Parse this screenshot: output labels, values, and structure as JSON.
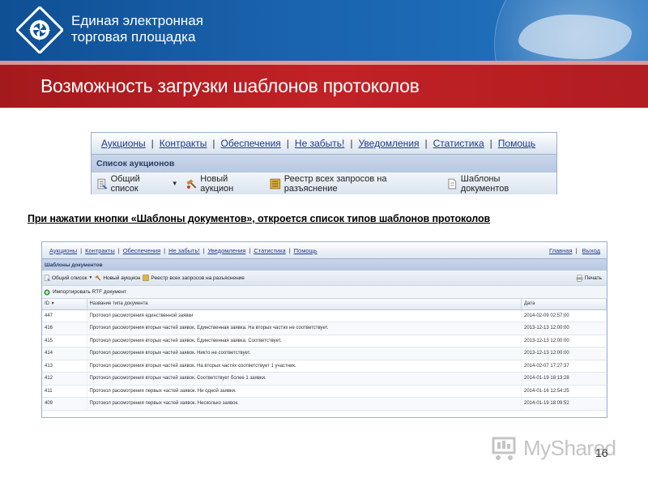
{
  "header": {
    "logo_line1": "Единая электронная",
    "logo_line2": "торговая площадка",
    "title": "Возможность загрузки шаблонов протоколов"
  },
  "panel_top": {
    "nav": [
      "Аукционы",
      "Контракты",
      "Обеспечения",
      "Не забыть!",
      "Уведомления",
      "Статистика",
      "Помощь"
    ],
    "section": "Список аукционов",
    "toolbar": [
      "Общий список",
      "Новый аукцион",
      "Реестр всех запросов на разъяснение",
      "Шаблоны документов"
    ]
  },
  "caption": "При нажатии кнопки «Шаблоны документов», откроется список типов шаблонов протоколов",
  "panel_list": {
    "nav": [
      "Аукционы",
      "Контракты",
      "Обеспечения",
      "Не забыть!",
      "Уведомления",
      "Статистика",
      "Помощь"
    ],
    "nav_right": [
      "Главная",
      "Выход"
    ],
    "section": "Шаблоны документов",
    "toolbar": [
      "Общий список",
      "Новый аукцион",
      "Реестр всех запросов на разъяснение"
    ],
    "print_label": "Печать",
    "import_label": "Импортировать RTF документ",
    "columns": [
      "ID",
      "Название типа документа",
      "Дата"
    ],
    "rows": [
      {
        "id": "447",
        "name": "Протокол рассмотрения единственной заявки",
        "date": "2014-02-09 02:57:00"
      },
      {
        "id": "416",
        "name": "Протокол рассмотрения вторых частей заявок. Единственная заявка. На вторых частях не соответствует.",
        "date": "2013-12-13 12:00:00"
      },
      {
        "id": "415",
        "name": "Протокол рассмотрения вторых частей заявок. Единственная заявка. Соответствует.",
        "date": "2013-12-13 12:00:00"
      },
      {
        "id": "414",
        "name": "Протокол рассмотрения вторых частей заявок. Никто не соответствует.",
        "date": "2013-12-13 12:00:00"
      },
      {
        "id": "413",
        "name": "Протокол рассмотрения вторых частей заявок. На вторых частях соответствует 1 участник.",
        "date": "2014-02-07 17:27:37"
      },
      {
        "id": "412",
        "name": "Протокол рассмотрения вторых частей заявок. Соответствует более 1 заявки.",
        "date": "2014-01-19 18:13:28"
      },
      {
        "id": "411",
        "name": "Протокол рассмотрения первых частей заявок. Ни одной заявки.",
        "date": "2014-01-16 12:54:25"
      },
      {
        "id": "409",
        "name": "Протокол рассмотрения первых частей заявок. Несколько заявок.",
        "date": "2014-01-19 18:09:52"
      }
    ]
  },
  "watermark": "MyShared",
  "page_number": "16",
  "colors": {
    "header_blue": "#1a63ad",
    "header_red": "#c12226",
    "link_blue": "#1f3c8a"
  }
}
